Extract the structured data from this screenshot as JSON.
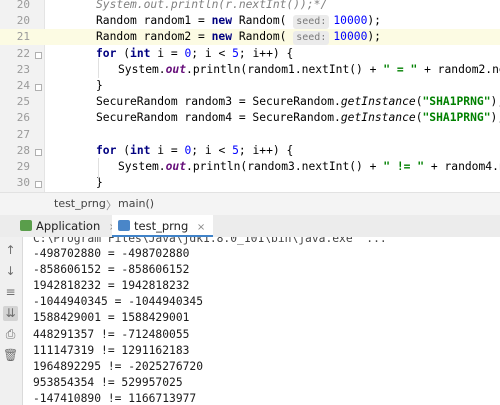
{
  "editor": {
    "lines": [
      {
        "num": "20",
        "current": false,
        "parts": [
          {
            "t": "System.",
            "c": "cmt"
          },
          {
            "t": "out",
            "c": "cmt"
          },
          {
            "t": ".println(r.nextInt());*/",
            "c": "cmt"
          }
        ]
      },
      {
        "num": "20",
        "current": false,
        "parts": [
          {
            "t": "Random random1 = ",
            "c": ""
          },
          {
            "t": "new",
            "c": "kw"
          },
          {
            "t": " Random( ",
            "c": ""
          },
          {
            "t": "seed:",
            "c": "hint"
          },
          {
            "t": "10000",
            "c": "num"
          },
          {
            "t": ");",
            "c": ""
          }
        ]
      },
      {
        "num": "21",
        "current": true,
        "parts": [
          {
            "t": "Random random2 = ",
            "c": ""
          },
          {
            "t": "new",
            "c": "kw"
          },
          {
            "t": " Random( ",
            "c": ""
          },
          {
            "t": "seed:",
            "c": "hint"
          },
          {
            "t": "10000",
            "c": "num"
          },
          {
            "t": ");",
            "c": ""
          }
        ]
      },
      {
        "num": "22",
        "current": false,
        "parts": [
          {
            "t": "for",
            "c": "kw"
          },
          {
            "t": " (",
            "c": ""
          },
          {
            "t": "int",
            "c": "kw"
          },
          {
            "t": " i = ",
            "c": ""
          },
          {
            "t": "0",
            "c": "num"
          },
          {
            "t": "; i < ",
            "c": ""
          },
          {
            "t": "5",
            "c": "num"
          },
          {
            "t": "; i++) {",
            "c": ""
          }
        ]
      },
      {
        "num": "23",
        "current": false,
        "indent": true,
        "parts": [
          {
            "t": "System.",
            "c": ""
          },
          {
            "t": "out",
            "c": "out"
          },
          {
            "t": ".println(random1.nextInt() + ",
            "c": ""
          },
          {
            "t": "\" = \"",
            "c": "str"
          },
          {
            "t": " + random2.nextInt());",
            "c": ""
          }
        ]
      },
      {
        "num": "24",
        "current": false,
        "parts": [
          {
            "t": "}",
            "c": ""
          }
        ]
      },
      {
        "num": "25",
        "current": false,
        "parts": [
          {
            "t": "SecureRandom random3 = SecureRandom.",
            "c": ""
          },
          {
            "t": "getInstance",
            "c": "it"
          },
          {
            "t": "(",
            "c": ""
          },
          {
            "t": "\"SHA1PRNG\"",
            "c": "str"
          },
          {
            "t": ");",
            "c": ""
          }
        ]
      },
      {
        "num": "26",
        "current": false,
        "parts": [
          {
            "t": "SecureRandom random4 = SecureRandom.",
            "c": ""
          },
          {
            "t": "getInstance",
            "c": "it"
          },
          {
            "t": "(",
            "c": ""
          },
          {
            "t": "\"SHA1PRNG\"",
            "c": "str"
          },
          {
            "t": ");",
            "c": ""
          }
        ]
      },
      {
        "num": "27",
        "current": false,
        "parts": []
      },
      {
        "num": "28",
        "current": false,
        "parts": [
          {
            "t": "for",
            "c": "kw"
          },
          {
            "t": " (",
            "c": ""
          },
          {
            "t": "int",
            "c": "kw"
          },
          {
            "t": " i = ",
            "c": ""
          },
          {
            "t": "0",
            "c": "num"
          },
          {
            "t": "; i < ",
            "c": ""
          },
          {
            "t": "5",
            "c": "num"
          },
          {
            "t": "; i++) {",
            "c": ""
          }
        ]
      },
      {
        "num": "29",
        "current": false,
        "indent": true,
        "parts": [
          {
            "t": "System.",
            "c": ""
          },
          {
            "t": "out",
            "c": "out"
          },
          {
            "t": ".println(random3.nextInt() + ",
            "c": ""
          },
          {
            "t": "\" != \"",
            "c": "str"
          },
          {
            "t": " + random4.nextInt());",
            "c": ""
          }
        ]
      },
      {
        "num": "30",
        "current": false,
        "parts": [
          {
            "t": "}",
            "c": ""
          }
        ]
      }
    ]
  },
  "breadcrumb": {
    "class_name": "test_prng",
    "separator": "〉",
    "method_name": "main()"
  },
  "run_tabs": [
    {
      "label": "Application",
      "close": "×",
      "active": false,
      "icon_color": "#5a9e4b"
    },
    {
      "label": "test_prng",
      "close": "×",
      "active": true,
      "icon_color": "#4a86c8"
    }
  ],
  "console": {
    "command": "C:\\Program Files\\Java\\jdk1.8.0_101\\bin\\java.exe\" ...",
    "output": [
      "-498702880 = -498702880",
      "-858606152 = -858606152",
      "1942818232 = 1942818232",
      "-1044940345 = -1044940345",
      "1588429001 = 1588429001",
      "448291357 != -712480055",
      "111147319 != 1291162183",
      "1964892295 != -2025276720",
      "953854354 != 529957025",
      "-147410890 != 1166713977"
    ],
    "tools": [
      {
        "name": "up-arrow-icon",
        "glyph": "↑"
      },
      {
        "name": "down-arrow-icon",
        "glyph": "↓"
      },
      {
        "name": "soft-wrap-icon",
        "glyph": "≡"
      },
      {
        "name": "scroll-to-end-icon",
        "glyph": "⇊"
      },
      {
        "name": "print-icon",
        "glyph": "⎙"
      },
      {
        "name": "trash-icon",
        "glyph": "🗑"
      }
    ]
  },
  "colors": {
    "accent": "#4083c9",
    "current_line": "#fcfbe3",
    "keyword": "#000080",
    "string": "#008000",
    "number": "#0000ff"
  }
}
